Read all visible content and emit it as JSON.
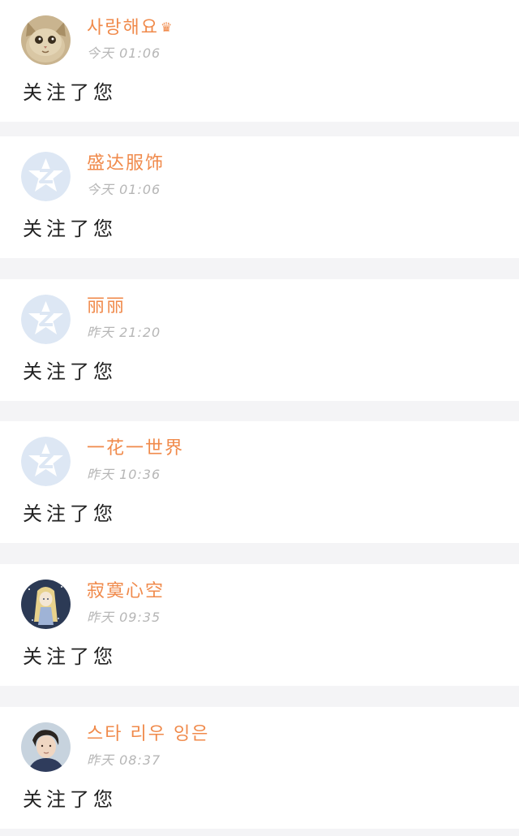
{
  "feed": {
    "items": [
      {
        "username": "사랑해요",
        "badge_icon": "crown-icon",
        "badge_glyph": "♛",
        "timestamp": "今天 01:06",
        "action": "关注了您",
        "avatar": "cat-photo-avatar"
      },
      {
        "username": "盛达服饰",
        "timestamp": "今天 01:06",
        "action": "关注了您",
        "avatar": "default-star-avatar"
      },
      {
        "username": "丽丽",
        "timestamp": "昨天 21:20",
        "action": "关注了您",
        "avatar": "default-star-avatar"
      },
      {
        "username": "一花一世界",
        "timestamp": "昨天 10:36",
        "action": "关注了您",
        "avatar": "default-star-avatar"
      },
      {
        "username": "寂寞心空",
        "timestamp": "昨天 09:35",
        "action": "关注了您",
        "avatar": "anime-girl-avatar"
      },
      {
        "username": "스타 리우 잉은",
        "timestamp": "昨天 08:37",
        "action": "关注了您",
        "avatar": "person-photo-avatar"
      }
    ]
  },
  "colors": {
    "username": "#f08a4b",
    "timestamp": "#b6b6b6",
    "action": "#222222",
    "separator": "#f4f4f6",
    "default_avatar_bg": "#dde7f4"
  }
}
